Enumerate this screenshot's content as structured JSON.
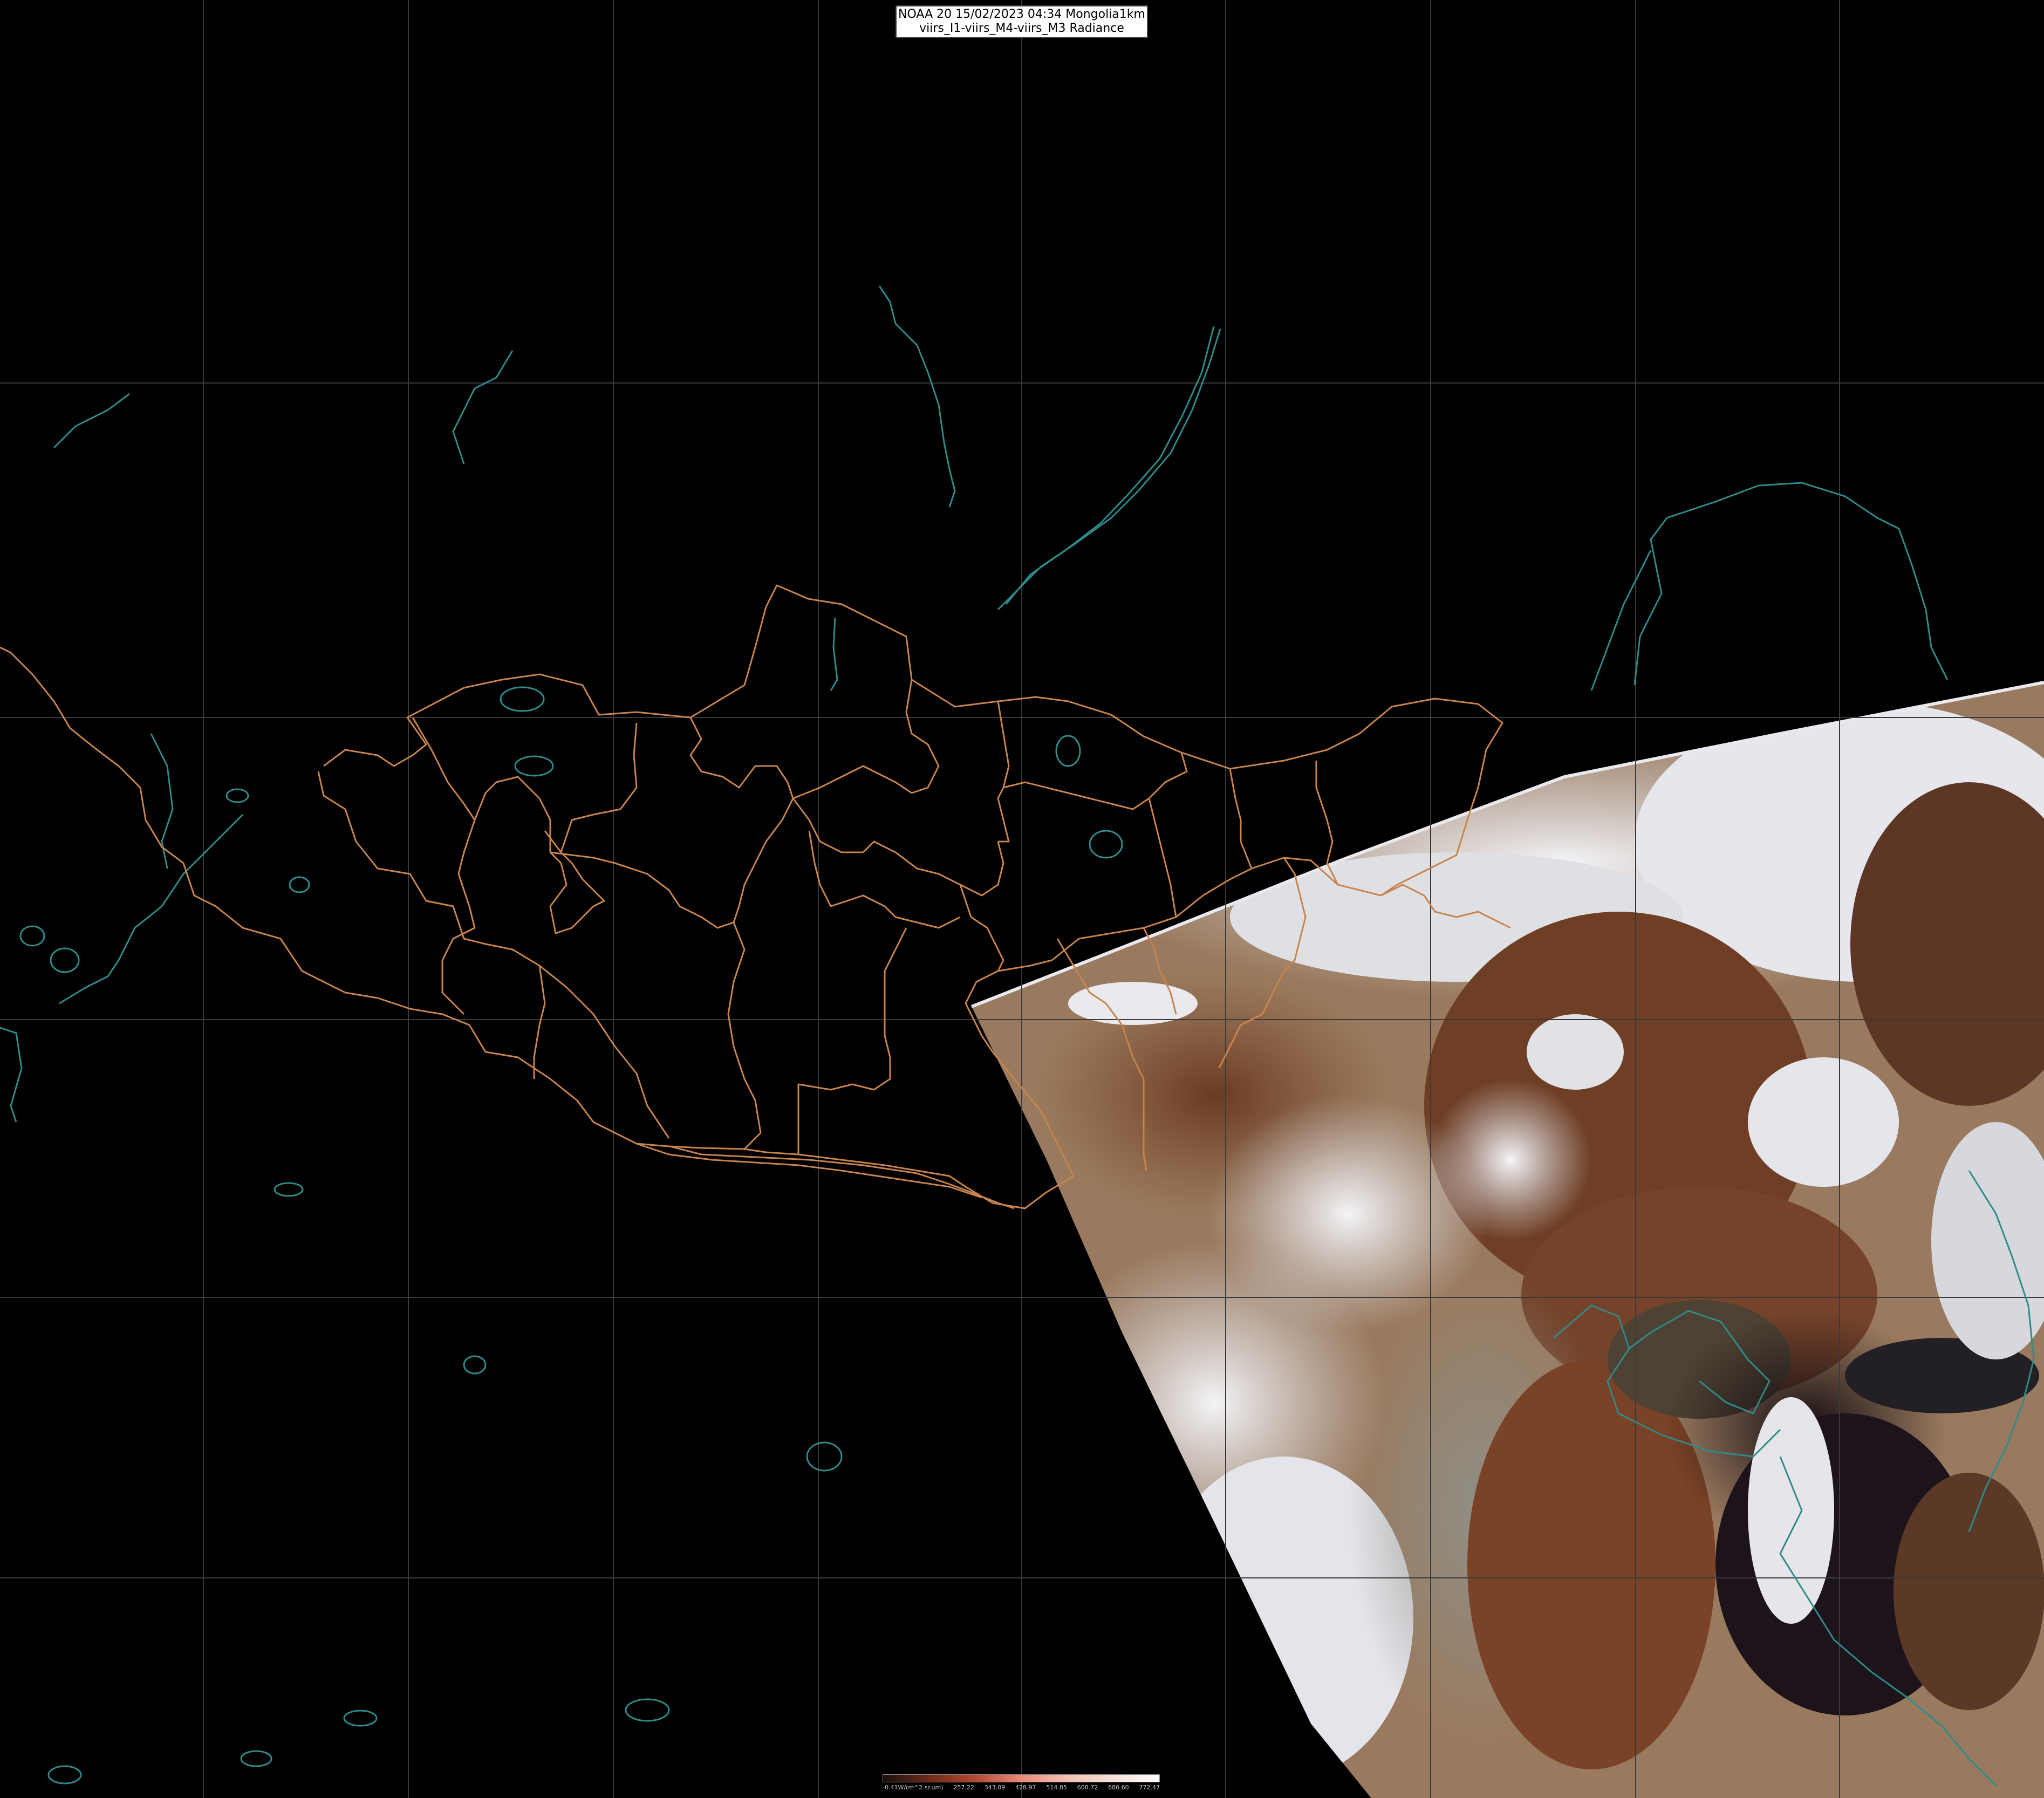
{
  "header": {
    "line1": "NOAA 20 15/02/2023 04:34 Mongolia1km",
    "line2": "viirs_I1-viirs_M4-viirs_M3 Radiance"
  },
  "colors": {
    "background": "#000000",
    "grid": "#3a3a3a",
    "border_admin": "#c8844c",
    "coastline": "#2f8a8a",
    "scene_snow": "#e8e9ee",
    "scene_land": "#7a4a2c",
    "scene_sea": "#1a1216"
  },
  "colorbar": {
    "stops": [
      "#1a1010",
      "#6e2a18",
      "#b44a32",
      "#e88a76",
      "#f4c2b4",
      "#f6e0d8",
      "#ffffff"
    ],
    "labels": [
      "-0.41W/(m^2.sr.um)",
      "257.22",
      "343.09",
      "428.97",
      "514.85",
      "600.72",
      "686.60",
      "772.47"
    ]
  }
}
